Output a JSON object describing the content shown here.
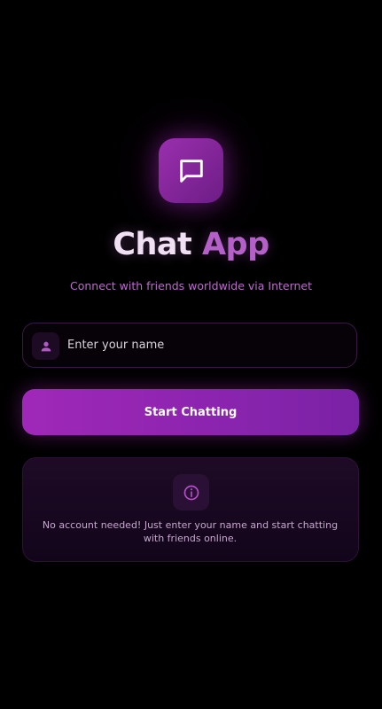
{
  "app": {
    "title_word1": "Chat",
    "title_word2": "App",
    "subtitle": "Connect with friends worldwide via Internet",
    "logo_icon": "chat-bubble-icon"
  },
  "login": {
    "name_placeholder": "Enter your name",
    "name_value": "",
    "field_icon": "person-icon",
    "start_button_label": "Start Chatting"
  },
  "info": {
    "icon": "info-icon",
    "text": "No account needed! Just enter your name and start chatting with friends online."
  },
  "colors": {
    "background": "#000000",
    "accent": "#9c27b0",
    "accent_light": "#b560c8",
    "title_light": "#f1dff4"
  }
}
